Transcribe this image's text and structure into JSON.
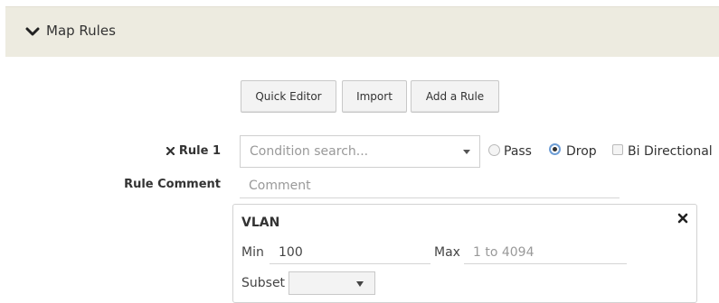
{
  "panel": {
    "title": "Map Rules",
    "icon": "chevron-down-icon"
  },
  "toolbar": {
    "quick_editor_label": "Quick Editor",
    "import_label": "Import",
    "add_rule_label": "Add a Rule"
  },
  "rule": {
    "label": "Rule 1",
    "remove_icon": "close-icon",
    "condition_placeholder": "Condition search...",
    "options": {
      "pass_label": "Pass",
      "drop_label": "Drop",
      "bidirectional_label": "Bi Directional",
      "selected": "Drop",
      "bidirectional_checked": false
    },
    "comment_label": "Rule Comment",
    "comment_placeholder": "Comment"
  },
  "vlan": {
    "title": "VLAN",
    "min_label": "Min",
    "min_value": "100",
    "max_label": "Max",
    "max_placeholder": "1 to 4094",
    "subset_label": "Subset",
    "subset_value": ""
  },
  "colors": {
    "header_bg": "#edebe0",
    "radio_focus": "#6e9ed6"
  }
}
